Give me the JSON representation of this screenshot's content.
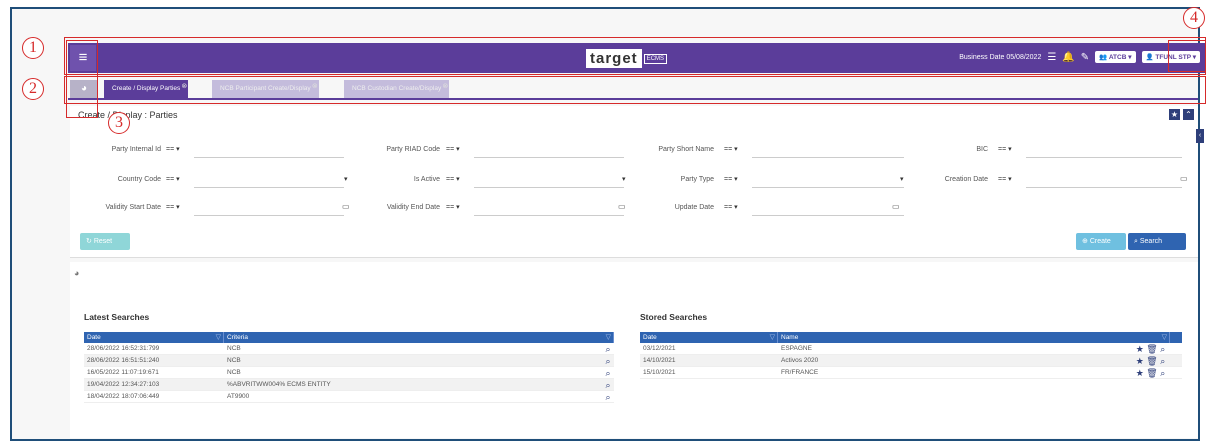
{
  "callouts": [
    "1",
    "2",
    "3",
    "4"
  ],
  "header": {
    "menu_icon": "hamburger-icon",
    "logo": "target",
    "logo_sub": "ECMS",
    "business_date": "Business Date 05/08/2022",
    "org_button": "ATCB",
    "user_button": "TFUNL STP"
  },
  "tabs": [
    {
      "label": "Create / Display Parties",
      "active": true
    },
    {
      "label": "NCB Participant Create/Display",
      "active": false
    },
    {
      "label": "NCB Custodian Create/Display",
      "active": false
    }
  ],
  "search_panel": {
    "title": "Create / Display : Parties",
    "operator": "==",
    "fields": [
      {
        "label": "Party Internal Id"
      },
      {
        "label": "Party RIAD Code"
      },
      {
        "label": "Party Short Name"
      },
      {
        "label": "BIC"
      },
      {
        "label": "Country Code"
      },
      {
        "label": "Is Active"
      },
      {
        "label": "Party Type"
      },
      {
        "label": "Creation Date"
      },
      {
        "label": "Validity Start Date"
      },
      {
        "label": "Validity End Date"
      },
      {
        "label": "Update Date"
      }
    ],
    "reset_label": "Reset",
    "create_label": "Create",
    "search_label": "Search"
  },
  "latest_searches": {
    "title": "Latest Searches",
    "columns": [
      "Date",
      "Criteria"
    ],
    "rows": [
      {
        "date": "28/06/2022 16:52:31:799",
        "criteria": "NCB"
      },
      {
        "date": "28/06/2022 16:51:51:240",
        "criteria": "NCB"
      },
      {
        "date": "16/05/2022 11:07:19:671",
        "criteria": "NCB"
      },
      {
        "date": "19/04/2022 12:34:27:103",
        "criteria": "%ABVRITWW004%  ECMS ENTITY"
      },
      {
        "date": "18/04/2022 18:07:06:449",
        "criteria": "AT9900"
      }
    ]
  },
  "stored_searches": {
    "title": "Stored Searches",
    "columns": [
      "Date",
      "Name"
    ],
    "rows": [
      {
        "date": "03/12/2021",
        "name": "ESPAGNE"
      },
      {
        "date": "14/10/2021",
        "name": "Activos 2020"
      },
      {
        "date": "15/10/2021",
        "name": "FR/FRANCE"
      }
    ]
  },
  "colors": {
    "brand": "#5b3d9a",
    "table_header": "#2f64b1",
    "annotation": "#d62a2a"
  }
}
